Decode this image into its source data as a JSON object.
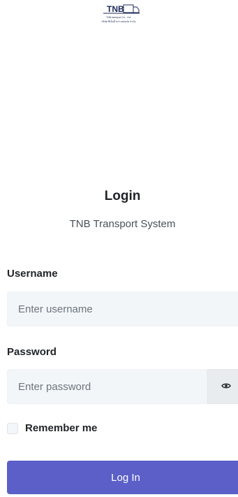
{
  "logo": {
    "text": "TNB",
    "line1": "TNB transport Co., Ltd.",
    "line2": "บริษัท ทีเอ็นบี ทรานสปอร์ต จำกัด"
  },
  "login": {
    "title": "Login",
    "subtitle": "TNB Transport System"
  },
  "username": {
    "label": "Username",
    "placeholder": "Enter username",
    "value": ""
  },
  "password": {
    "label": "Password",
    "placeholder": "Enter password",
    "value": "",
    "toggle_icon": "eye-icon"
  },
  "remember": {
    "label": "Remember me",
    "checked": false
  },
  "submit": {
    "label": "Log In"
  },
  "colors": {
    "primary": "#5b5fc7",
    "input_bg": "#f3f6f9"
  }
}
